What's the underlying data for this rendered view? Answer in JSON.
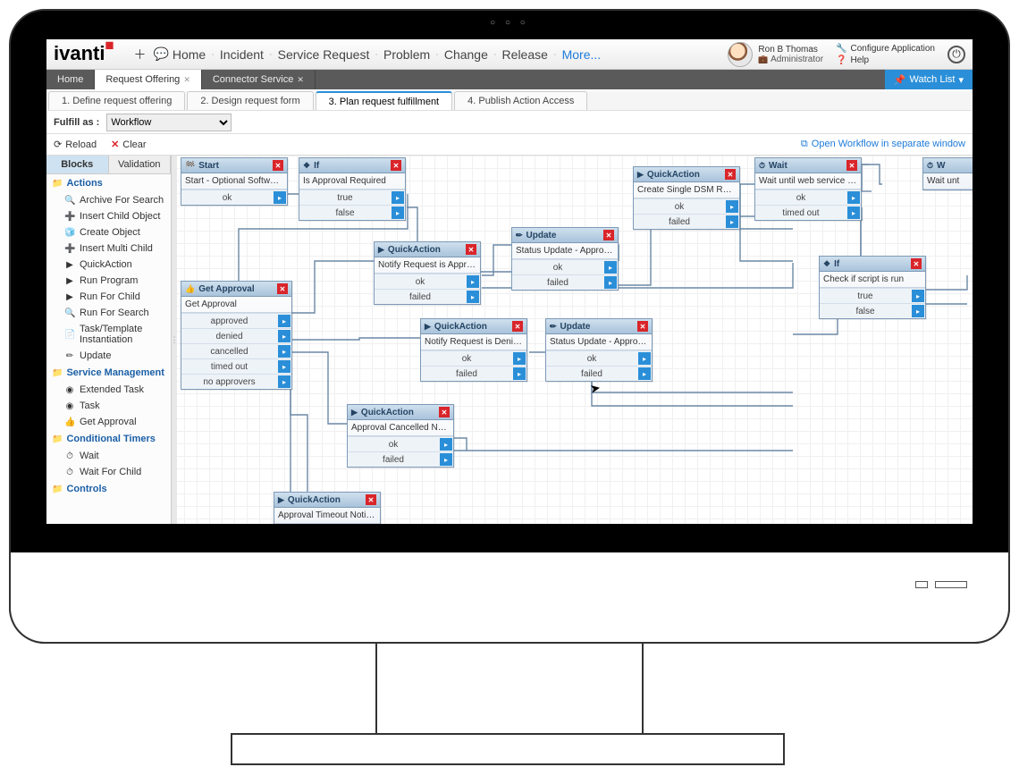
{
  "topnav": {
    "home": "Home",
    "incident": "Incident",
    "service_request": "Service Request",
    "problem": "Problem",
    "change": "Change",
    "release": "Release",
    "more": "More..."
  },
  "user": {
    "name": "Ron B Thomas",
    "role": "Administrator"
  },
  "config_links": {
    "configure": "Configure Application",
    "help": "Help"
  },
  "subtabs": {
    "home": "Home",
    "req_offering": "Request Offering",
    "connector": "Connector Service",
    "watch": "Watch List"
  },
  "wizard": {
    "s1": "1. Define request offering",
    "s2": "2. Design request form",
    "s3": "3. Plan request fulfillment",
    "s4": "4. Publish Action Access"
  },
  "fulfill": {
    "label": "Fulfill as :",
    "value": "Workflow"
  },
  "toolbar": {
    "reload": "Reload",
    "clear": "Clear",
    "open": "Open Workflow in separate window"
  },
  "side_tabs": {
    "blocks": "Blocks",
    "validation": "Validation"
  },
  "side_groups": {
    "actions": "Actions",
    "service_mgmt": "Service Management",
    "cond_timers": "Conditional Timers",
    "controls": "Controls"
  },
  "actions": {
    "archive": "Archive For Search",
    "insert_child": "Insert Child Object",
    "create_obj": "Create Object",
    "insert_multi": "Insert Multi Child",
    "quick_action": "QuickAction",
    "run_program": "Run Program",
    "run_for_child": "Run For Child",
    "run_for_search": "Run For Search",
    "task_template": "Task/Template Instantiation",
    "update": "Update"
  },
  "svc_mgmt": {
    "ext_task": "Extended Task",
    "task": "Task",
    "get_approval": "Get Approval"
  },
  "timers": {
    "wait": "Wait",
    "wait_child": "Wait For Child"
  },
  "outcomes": {
    "ok": "ok",
    "true": "true",
    "false": "false",
    "failed": "failed",
    "approved": "approved",
    "denied": "denied",
    "cancelled": "cancelled",
    "timed_out": "timed out",
    "no_approvers": "no approvers"
  },
  "nodes": {
    "start": {
      "title": "Start",
      "body": "Start - Optional Software Install"
    },
    "if1": {
      "title": "If",
      "body": "Is Approval Required"
    },
    "qa_create_dsm": {
      "title": "QuickAction",
      "body": "Create Single DSM Request"
    },
    "wait": {
      "title": "Wait",
      "body": "Wait until web service script has"
    },
    "wait2": {
      "title": "W",
      "body": "Wait unt"
    },
    "if2": {
      "title": "If",
      "body": "Check if script is run"
    },
    "get_approval": {
      "title": "Get Approval",
      "body": "Get Approval"
    },
    "qa_notify_approved": {
      "title": "QuickAction",
      "body": "Notify Request is Approved"
    },
    "update_approved": {
      "title": "Update",
      "body": "Status Update - Approved"
    },
    "qa_notify_denied": {
      "title": "QuickAction",
      "body": "Notify Request is Denied"
    },
    "update_rejected": {
      "title": "Update",
      "body": "Status Update - Approval Rejec"
    },
    "qa_cancelled": {
      "title": "QuickAction",
      "body": "Approval Cancelled Notification"
    },
    "qa_timeout": {
      "title": "QuickAction",
      "body": "Approval Timeout Notification to"
    }
  }
}
